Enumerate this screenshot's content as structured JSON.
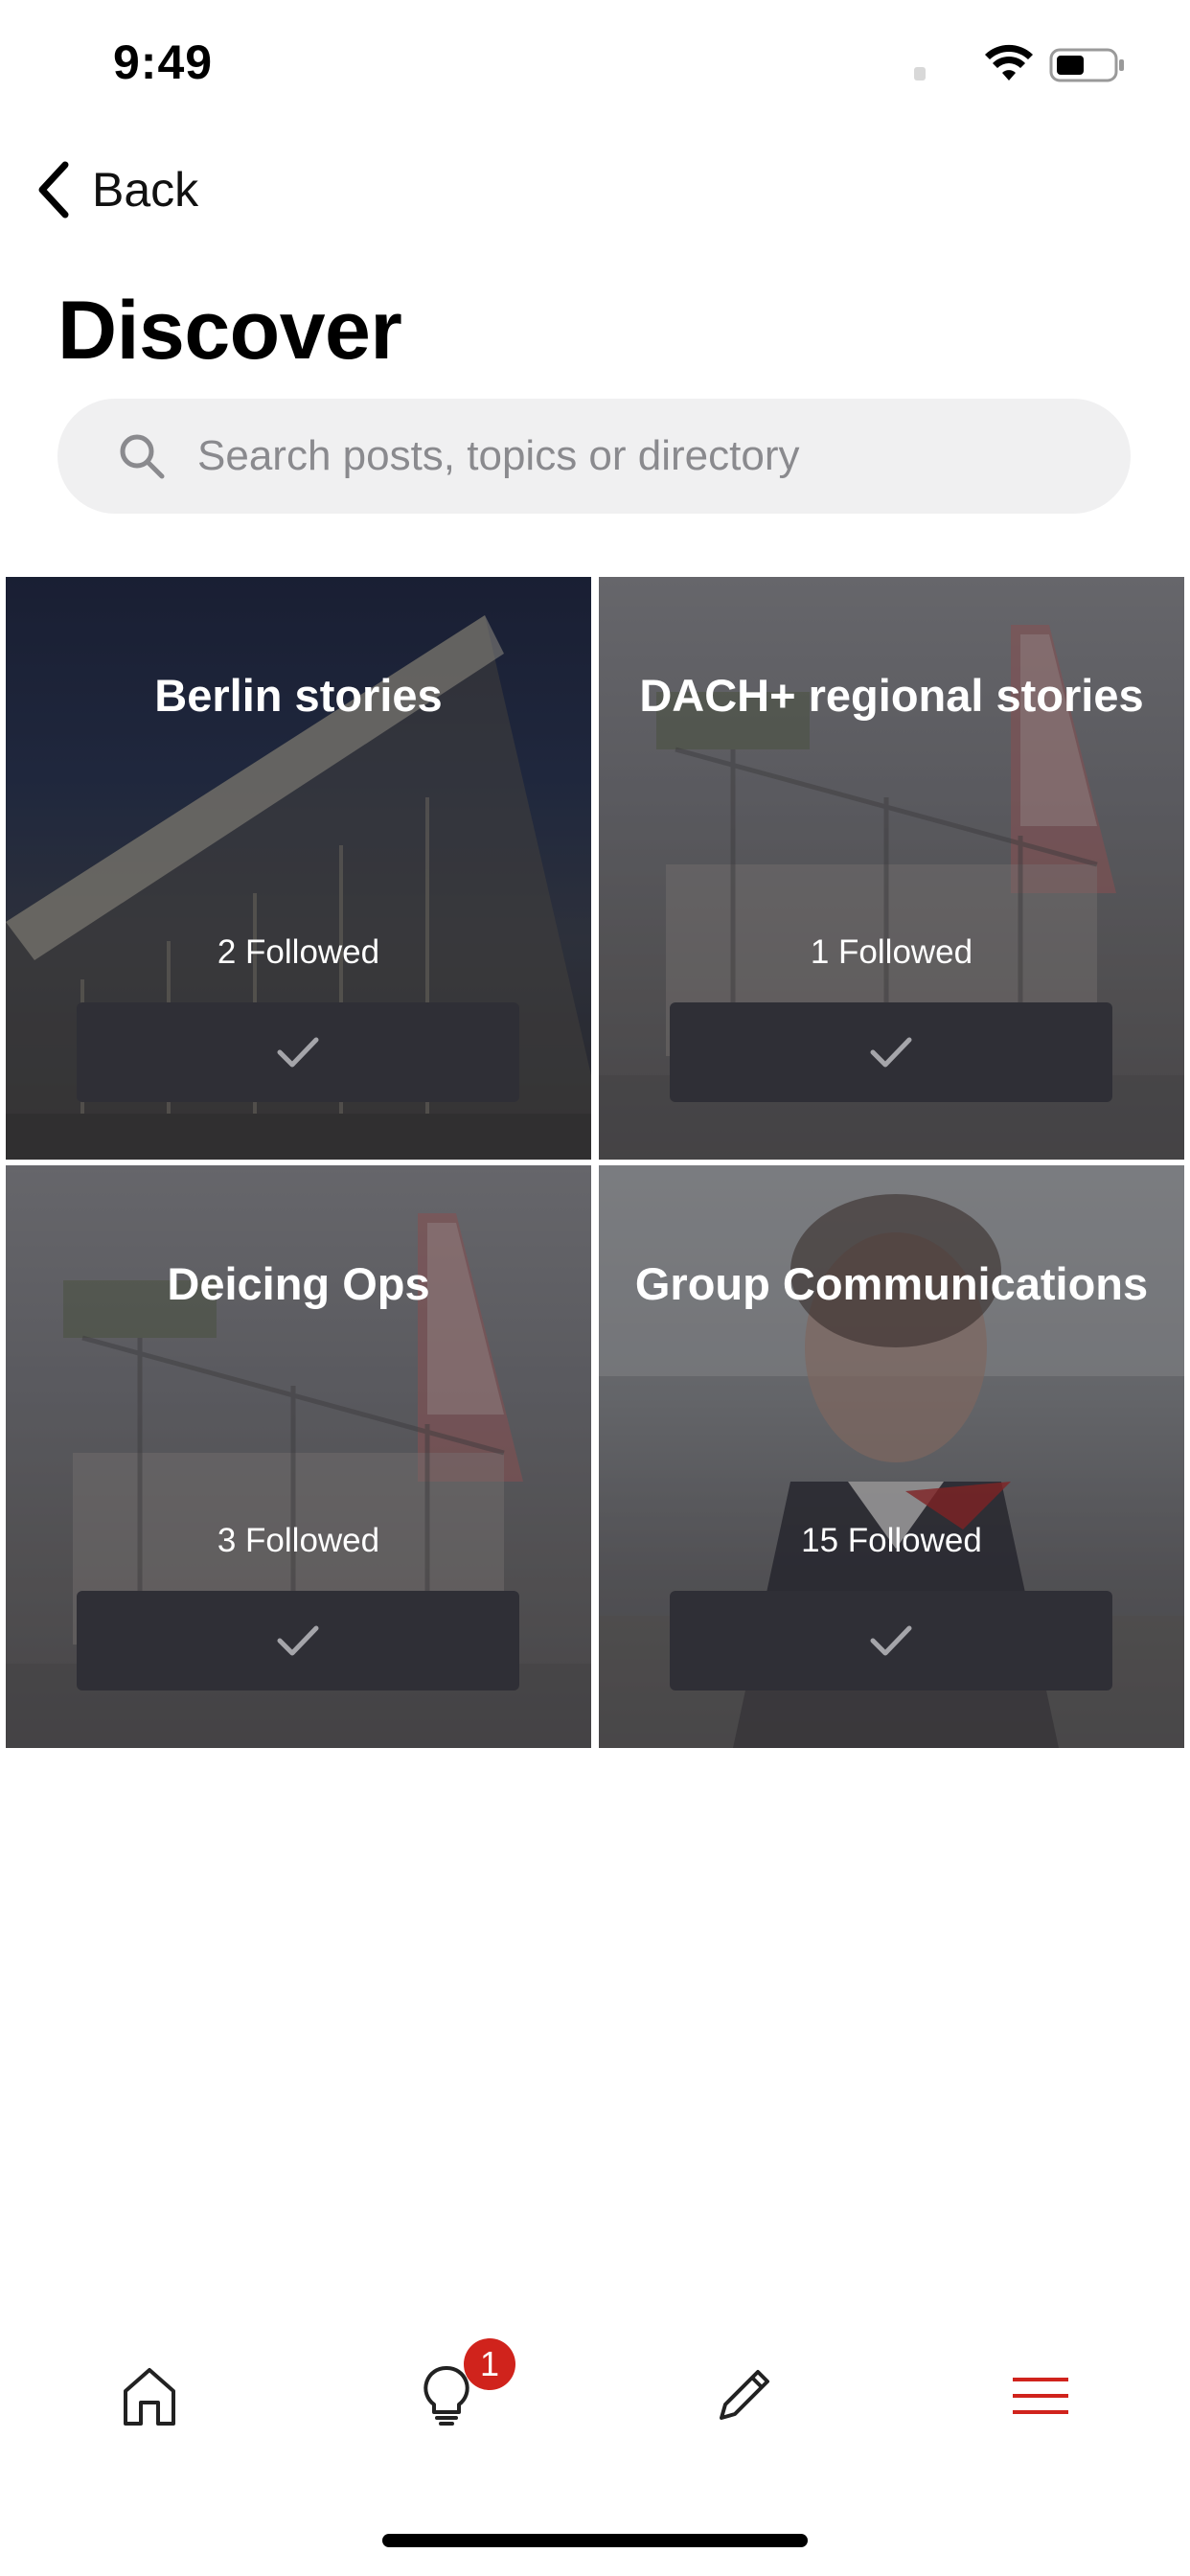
{
  "status_bar": {
    "time": "9:49"
  },
  "header": {
    "back_label": "Back",
    "title": "Discover"
  },
  "search": {
    "placeholder": "Search posts, topics or directory"
  },
  "topics": [
    {
      "title": "Berlin stories",
      "followed": "2 Followed"
    },
    {
      "title": "DACH+ regional stories",
      "followed": "1 Followed"
    },
    {
      "title": "Deicing Ops",
      "followed": "3 Followed"
    },
    {
      "title": "Group Communications",
      "followed": "15 Followed"
    }
  ],
  "tab_bar": {
    "ideas_badge": "1",
    "active_color": "#d0231c"
  }
}
